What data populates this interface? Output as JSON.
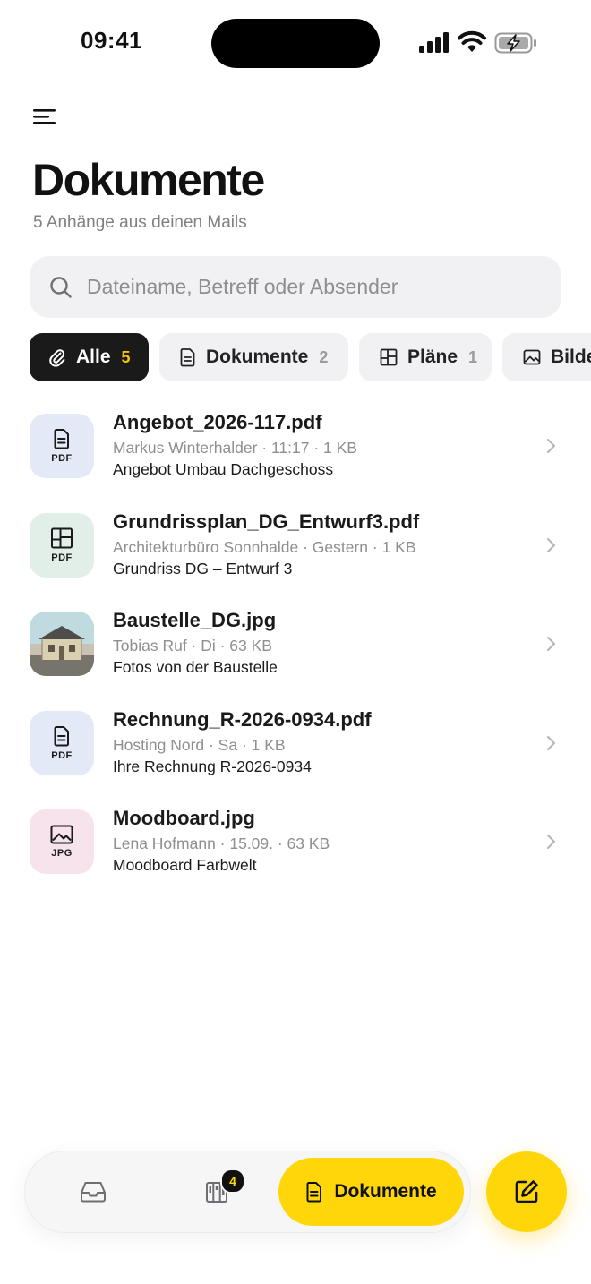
{
  "status": {
    "time": "09:41"
  },
  "header": {
    "title": "Dokumente",
    "subtitle": "5 Anhänge aus deinen Mails"
  },
  "search": {
    "placeholder": "Dateiname, Betreff oder Absender",
    "value": ""
  },
  "filters": [
    {
      "label": "Alle",
      "count": "5",
      "icon": "paperclip-icon",
      "active": true
    },
    {
      "label": "Dokumente",
      "count": "2",
      "icon": "document-icon",
      "active": false
    },
    {
      "label": "Pläne",
      "count": "1",
      "icon": "floorplan-icon",
      "active": false
    },
    {
      "label": "Bilder",
      "count": "",
      "icon": "image-icon",
      "active": false
    }
  ],
  "files": [
    {
      "name": "Angebot_2026-117.pdf",
      "meta": "Markus Winterhalder · 11:17 · 1 KB",
      "subject": "Angebot Umbau Dachgeschoss",
      "type": "PDF",
      "icon": "document-icon",
      "tint": "#e3e9f6"
    },
    {
      "name": "Grundrissplan_DG_Entwurf3.pdf",
      "meta": "Architekturbüro Sonnhalde · Gestern · 1 KB",
      "subject": "Grundriss DG – Entwurf 3",
      "type": "PDF",
      "icon": "floorplan-icon",
      "tint": "#e2efe8"
    },
    {
      "name": "Baustelle_DG.jpg",
      "meta": "Tobias Ruf · Di · 63 KB",
      "subject": "Fotos von der Baustelle",
      "type": "",
      "icon": "photo-thumbnail",
      "tint": ""
    },
    {
      "name": "Rechnung_R-2026-0934.pdf",
      "meta": "Hosting Nord · Sa · 1 KB",
      "subject": "Ihre Rechnung R-2026-0934",
      "type": "PDF",
      "icon": "document-icon",
      "tint": "#e3e9f6"
    },
    {
      "name": "Moodboard.jpg",
      "meta": "Lena Hofmann · 15.09. · 63 KB",
      "subject": "Moodboard Farbwelt",
      "type": "JPG",
      "icon": "image-icon",
      "tint": "#f6e3ec"
    }
  ],
  "nav": {
    "items": [
      {
        "icon": "inbox-icon"
      },
      {
        "icon": "board-icon",
        "badge": "4"
      }
    ],
    "active_label": "Dokumente",
    "active_icon": "document-icon"
  },
  "fab": {
    "icon": "compose-icon"
  },
  "colors": {
    "accent": "#ffd60a",
    "dark": "#1a1a1a",
    "muted": "#8e8e93"
  }
}
